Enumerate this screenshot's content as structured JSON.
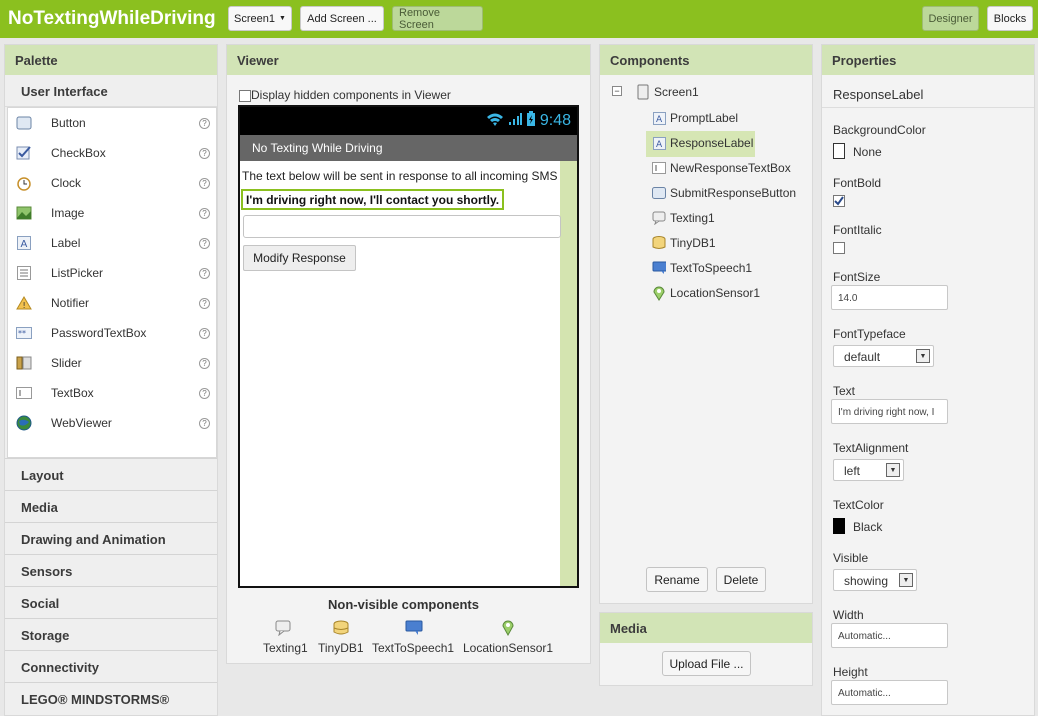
{
  "topbar": {
    "app_title": "NoTextingWhileDriving",
    "screen_select": "Screen1",
    "add_screen": "Add Screen ...",
    "remove_screen": "Remove Screen",
    "designer": "Designer",
    "blocks": "Blocks"
  },
  "palette": {
    "title": "Palette",
    "active_category": "User Interface",
    "items": [
      {
        "label": "Button",
        "icon": "button-icon"
      },
      {
        "label": "CheckBox",
        "icon": "checkbox-icon"
      },
      {
        "label": "Clock",
        "icon": "clock-icon"
      },
      {
        "label": "Image",
        "icon": "image-icon"
      },
      {
        "label": "Label",
        "icon": "label-icon"
      },
      {
        "label": "ListPicker",
        "icon": "listpicker-icon"
      },
      {
        "label": "Notifier",
        "icon": "notifier-icon"
      },
      {
        "label": "PasswordTextBox",
        "icon": "password-icon"
      },
      {
        "label": "Slider",
        "icon": "slider-icon"
      },
      {
        "label": "TextBox",
        "icon": "textbox-icon"
      },
      {
        "label": "WebViewer",
        "icon": "webviewer-icon"
      }
    ],
    "categories": [
      "Layout",
      "Media",
      "Drawing and Animation",
      "Sensors",
      "Social",
      "Storage",
      "Connectivity",
      "LEGO® MINDSTORMS®"
    ]
  },
  "viewer": {
    "title": "Viewer",
    "hidden_toggle": "Display hidden components in Viewer",
    "time": "9:48",
    "app_title": "No Texting While Driving",
    "prompt_text": "The text below will be sent in response to all incoming SMS",
    "response_text": "I'm driving right now, I'll contact you shortly.",
    "textbox_value": "",
    "button_label": "Modify Response",
    "nonvisible_title": "Non-visible components",
    "nonvisible": [
      {
        "label": "Texting1",
        "icon": "texting-icon"
      },
      {
        "label": "TinyDB1",
        "icon": "tinydb-icon"
      },
      {
        "label": "TextToSpeech1",
        "icon": "tts-icon"
      },
      {
        "label": "LocationSensor1",
        "icon": "location-icon"
      }
    ]
  },
  "components": {
    "title": "Components",
    "root": "Screen1",
    "children": [
      "PromptLabel",
      "ResponseLabel",
      "NewResponseTextBox",
      "SubmitResponseButton",
      "Texting1",
      "TinyDB1",
      "TextToSpeech1",
      "LocationSensor1"
    ],
    "selected": "ResponseLabel",
    "rename": "Rename",
    "delete": "Delete"
  },
  "media": {
    "title": "Media",
    "upload": "Upload File ..."
  },
  "properties": {
    "title": "Properties",
    "component": "ResponseLabel",
    "background_color_label": "BackgroundColor",
    "background_color_value": "None",
    "font_bold_label": "FontBold",
    "font_bold_checked": true,
    "font_italic_label": "FontItalic",
    "font_italic_checked": false,
    "font_size_label": "FontSize",
    "font_size_value": "14.0",
    "font_typeface_label": "FontTypeface",
    "font_typeface_value": "default",
    "text_label": "Text",
    "text_value": "I'm driving right now, I",
    "text_alignment_label": "TextAlignment",
    "text_alignment_value": "left",
    "text_color_label": "TextColor",
    "text_color_value": "Black",
    "visible_label": "Visible",
    "visible_value": "showing",
    "width_label": "Width",
    "width_value": "Automatic...",
    "height_label": "Height",
    "height_value": "Automatic..."
  },
  "colors": {
    "brand_green": "#8bc01f",
    "panel_header": "#d2e4b6",
    "selected_bg": "#d6e6b4"
  }
}
